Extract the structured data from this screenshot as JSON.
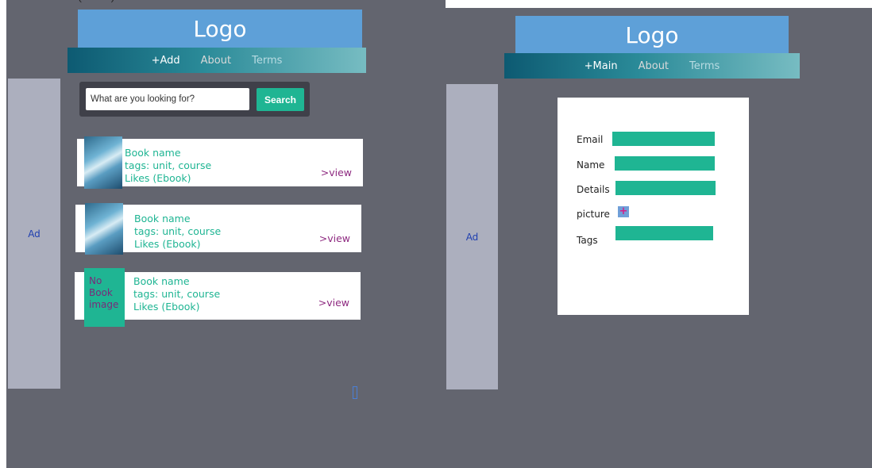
{
  "left": {
    "logo": "Logo",
    "nav": {
      "add": "+Add",
      "about": "About",
      "terms": "Terms"
    },
    "ad": "Ad",
    "search": {
      "placeholder": "What are you looking for?",
      "button": "Search"
    },
    "cards": [
      {
        "name": "Book name",
        "tags": "tags: unit, course",
        "likes": "Likes (Ebook)",
        "view": ">view",
        "image": "book-cover"
      },
      {
        "name": "Book name",
        "tags": "tags: unit, course",
        "likes": "Likes (Ebook)",
        "view": ">view",
        "image": "book-cover"
      },
      {
        "name": "Book name",
        "tags": "tags: unit, course",
        "likes": "Likes (Ebook)",
        "view": ">view",
        "no_image_text": "No Book image"
      }
    ]
  },
  "right": {
    "logo": "Logo",
    "nav": {
      "main": "+Main",
      "about": "About",
      "terms": "Terms"
    },
    "ad": "Ad",
    "form": {
      "email": "Email",
      "name": "Name",
      "details": "Details",
      "picture": "picture",
      "picture_button": "+",
      "tags": "Tags"
    }
  },
  "colors": {
    "background": "#63656f",
    "logo": "#5ea0d8",
    "accent": "#1fb593",
    "ad": "#acafbe",
    "link": "#8e2a80"
  }
}
